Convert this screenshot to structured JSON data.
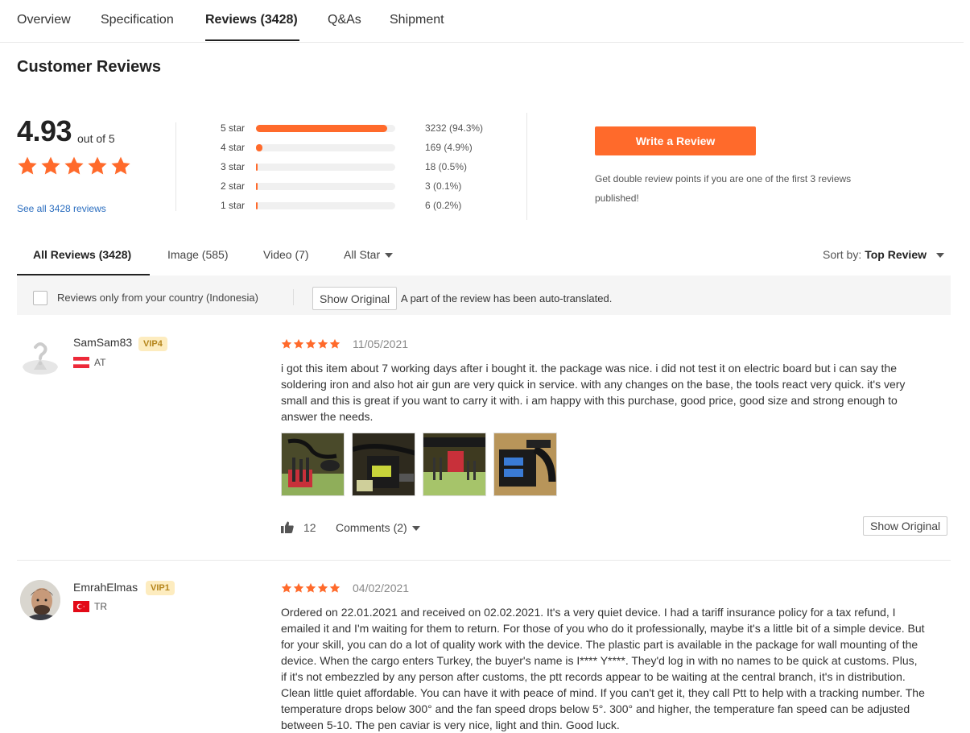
{
  "nav": {
    "tabs": [
      "Overview",
      "Specification",
      "Reviews (3428)",
      "Q&As",
      "Shipment"
    ]
  },
  "heading": "Customer Reviews",
  "summary": {
    "score": "4.93",
    "out_of": "out of 5",
    "stars_filled": 5,
    "see_all": "See all 3428 reviews"
  },
  "histogram": [
    {
      "label": "5 star",
      "count": "3232 (94.3%)",
      "fraction": 0.943
    },
    {
      "label": "4 star",
      "count": "169 (4.9%)",
      "fraction": 0.049
    },
    {
      "label": "3 star",
      "count": "18 (0.5%)",
      "fraction": 0.005
    },
    {
      "label": "2 star",
      "count": "3 (0.1%)",
      "fraction": 0.001
    },
    {
      "label": "1 star",
      "count": "6 (0.2%)",
      "fraction": 0.002
    }
  ],
  "write_review": {
    "label": "Write a Review",
    "promo": "Get double review points if you are one of the first 3 reviews published!"
  },
  "filters": {
    "tabs": [
      "All Reviews (3428)",
      "Image (585)",
      "Video (7)",
      "All Star"
    ],
    "sort_label": "Sort by:",
    "sort_value": "Top Review",
    "country_checkbox": "Reviews only from your country (Indonesia)",
    "show_original": "Show Original",
    "auto_note": "A part of the review has been auto-translated."
  },
  "colors": {
    "accent": "#ff6a2b",
    "link": "#2a6dbf",
    "vip_bg": "#fdecbf",
    "vip_text": "#b5851c"
  },
  "reviews": [
    {
      "user": "SamSam83",
      "vip": "VIP4",
      "country": "AT",
      "rating": 5,
      "date": "11/05/2021",
      "text": "i got this item about 7 working days after i bought it. the package was nice. i did not test it on electric board but i can say the soldering iron and also hot air gun are very quick in service. with any changes on the base, the tools react very quick. it's very small and this is great if you want to carry it with. i am happy with this purchase, good price, good size and strong enough to answer the needs.",
      "likes": "12",
      "comments": "Comments (2)",
      "show_original": "Show Original"
    },
    {
      "user": "EmrahElmas",
      "vip": "VIP1",
      "country": "TR",
      "rating": 5,
      "date": "04/02/2021",
      "text": "Ordered on 22.01.2021 and received on 02.02.2021. It's a very quiet device. I had a tariff insurance policy for a tax refund, I emailed it and I'm waiting for them to return. For those of you who do it professionally, maybe it's a little bit of a simple device. But for your skill, you can do a lot of quality work with the device. The plastic part is available in the package for wall mounting of the device. When the cargo enters Turkey, the buyer's name is I**** Y****. They'd log in with no names to be quick at customs. Plus, if it's not embezzled by any person after customs, the ptt records appear to be waiting at the central branch, it's in distribution. Clean little quiet affordable. You can have it with peace of mind. If you can't get it, they call Ptt to help with a tracking number. The temperature drops below 300° and the fan speed drops below 5°. 300° and higher, the temperature fan speed can be adjusted between 5-10. The pen caviar is very nice, light and thin. Good luck."
    }
  ]
}
